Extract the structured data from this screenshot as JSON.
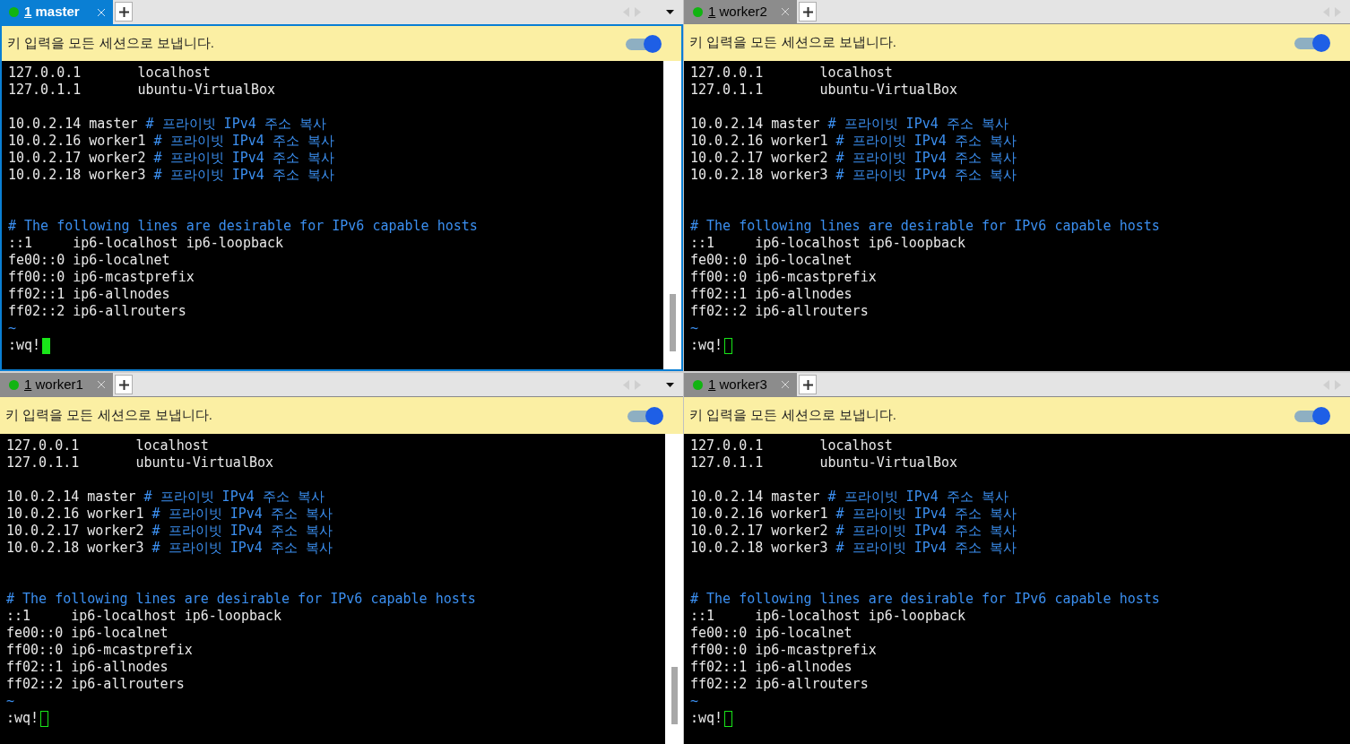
{
  "panes": [
    {
      "tab": {
        "number": "1",
        "label": "master",
        "selected": true
      },
      "banner": {
        "text": "키 입력을 모든 세션으로 보냅니다.",
        "on": true
      },
      "lines": [
        {
          "kind": "text",
          "text": "127.0.0.1       localhost"
        },
        {
          "kind": "text",
          "text": "127.0.1.1       ubuntu-VirtualBox"
        },
        {
          "kind": "blank"
        },
        {
          "kind": "text",
          "text": "10.0.2.14 master ",
          "comment": "# 프라이빗 IPv4 주소 복사"
        },
        {
          "kind": "text",
          "text": "10.0.2.16 worker1 ",
          "comment": "# 프라이빗 IPv4 주소 복사"
        },
        {
          "kind": "text",
          "text": "10.0.2.17 worker2 ",
          "comment": "# 프라이빗 IPv4 주소 복사"
        },
        {
          "kind": "text",
          "text": "10.0.2.18 worker3 ",
          "comment": "# 프라이빗 IPv4 주소 복사"
        },
        {
          "kind": "blank"
        },
        {
          "kind": "blank"
        },
        {
          "kind": "text",
          "comment": "# The following lines are desirable for IPv6 capable hosts"
        },
        {
          "kind": "text",
          "text": "::1     ip6-localhost ip6-loopback"
        },
        {
          "kind": "text",
          "text": "fe00::0 ip6-localnet"
        },
        {
          "kind": "text",
          "text": "ff00::0 ip6-mcastprefix"
        },
        {
          "kind": "text",
          "text": "ff02::1 ip6-allnodes"
        },
        {
          "kind": "text",
          "text": "ff02::2 ip6-allrouters"
        },
        {
          "kind": "text",
          "comment": "~"
        }
      ],
      "command": ":wq!"
    },
    {
      "tab": {
        "number": "1",
        "label": "worker2",
        "selected": false
      },
      "banner": {
        "text": "키 입력을 모든 세션으로 보냅니다.",
        "on": true
      },
      "lines": [
        {
          "kind": "text",
          "text": "127.0.0.1       localhost"
        },
        {
          "kind": "text",
          "text": "127.0.1.1       ubuntu-VirtualBox"
        },
        {
          "kind": "blank"
        },
        {
          "kind": "text",
          "text": "10.0.2.14 master ",
          "comment": "# 프라이빗 IPv4 주소 복사"
        },
        {
          "kind": "text",
          "text": "10.0.2.16 worker1 ",
          "comment": "# 프라이빗 IPv4 주소 복사"
        },
        {
          "kind": "text",
          "text": "10.0.2.17 worker2 ",
          "comment": "# 프라이빗 IPv4 주소 복사"
        },
        {
          "kind": "text",
          "text": "10.0.2.18 worker3 ",
          "comment": "# 프라이빗 IPv4 주소 복사"
        },
        {
          "kind": "blank"
        },
        {
          "kind": "blank"
        },
        {
          "kind": "text",
          "comment": "# The following lines are desirable for IPv6 capable hosts"
        },
        {
          "kind": "text",
          "text": "::1     ip6-localhost ip6-loopback"
        },
        {
          "kind": "text",
          "text": "fe00::0 ip6-localnet"
        },
        {
          "kind": "text",
          "text": "ff00::0 ip6-mcastprefix"
        },
        {
          "kind": "text",
          "text": "ff02::1 ip6-allnodes"
        },
        {
          "kind": "text",
          "text": "ff02::2 ip6-allrouters"
        },
        {
          "kind": "text",
          "comment": "~"
        }
      ],
      "command": ":wq!"
    },
    {
      "tab": {
        "number": "1",
        "label": "worker1",
        "selected": false
      },
      "banner": {
        "text": "키 입력을 모든 세션으로 보냅니다.",
        "on": true
      },
      "lines": [
        {
          "kind": "text",
          "text": "127.0.0.1       localhost"
        },
        {
          "kind": "text",
          "text": "127.0.1.1       ubuntu-VirtualBox"
        },
        {
          "kind": "blank"
        },
        {
          "kind": "text",
          "text": "10.0.2.14 master ",
          "comment": "# 프라이빗 IPv4 주소 복사"
        },
        {
          "kind": "text",
          "text": "10.0.2.16 worker1 ",
          "comment": "# 프라이빗 IPv4 주소 복사"
        },
        {
          "kind": "text",
          "text": "10.0.2.17 worker2 ",
          "comment": "# 프라이빗 IPv4 주소 복사"
        },
        {
          "kind": "text",
          "text": "10.0.2.18 worker3 ",
          "comment": "# 프라이빗 IPv4 주소 복사"
        },
        {
          "kind": "blank"
        },
        {
          "kind": "blank"
        },
        {
          "kind": "text",
          "comment": "# The following lines are desirable for IPv6 capable hosts"
        },
        {
          "kind": "text",
          "text": "::1     ip6-localhost ip6-loopback"
        },
        {
          "kind": "text",
          "text": "fe00::0 ip6-localnet"
        },
        {
          "kind": "text",
          "text": "ff00::0 ip6-mcastprefix"
        },
        {
          "kind": "text",
          "text": "ff02::1 ip6-allnodes"
        },
        {
          "kind": "text",
          "text": "ff02::2 ip6-allrouters"
        },
        {
          "kind": "text",
          "comment": "~"
        }
      ],
      "command": ":wq!"
    },
    {
      "tab": {
        "number": "1",
        "label": "worker3",
        "selected": false
      },
      "banner": {
        "text": "키 입력을 모든 세션으로 보냅니다.",
        "on": true
      },
      "lines": [
        {
          "kind": "text",
          "text": "127.0.0.1       localhost"
        },
        {
          "kind": "text",
          "text": "127.0.1.1       ubuntu-VirtualBox"
        },
        {
          "kind": "blank"
        },
        {
          "kind": "text",
          "text": "10.0.2.14 master ",
          "comment": "# 프라이빗 IPv4 주소 복사"
        },
        {
          "kind": "text",
          "text": "10.0.2.16 worker1 ",
          "comment": "# 프라이빗 IPv4 주소 복사"
        },
        {
          "kind": "text",
          "text": "10.0.2.17 worker2 ",
          "comment": "# 프라이빗 IPv4 주소 복사"
        },
        {
          "kind": "text",
          "text": "10.0.2.18 worker3 ",
          "comment": "# 프라이빗 IPv4 주소 복사"
        },
        {
          "kind": "blank"
        },
        {
          "kind": "blank"
        },
        {
          "kind": "text",
          "comment": "# The following lines are desirable for IPv6 capable hosts"
        },
        {
          "kind": "text",
          "text": "::1     ip6-localhost ip6-loopback"
        },
        {
          "kind": "text",
          "text": "fe00::0 ip6-localnet"
        },
        {
          "kind": "text",
          "text": "ff00::0 ip6-mcastprefix"
        },
        {
          "kind": "text",
          "text": "ff02::1 ip6-allnodes"
        },
        {
          "kind": "text",
          "text": "ff02::2 ip6-allrouters"
        },
        {
          "kind": "text",
          "comment": "~"
        }
      ],
      "command": ":wq!"
    }
  ]
}
